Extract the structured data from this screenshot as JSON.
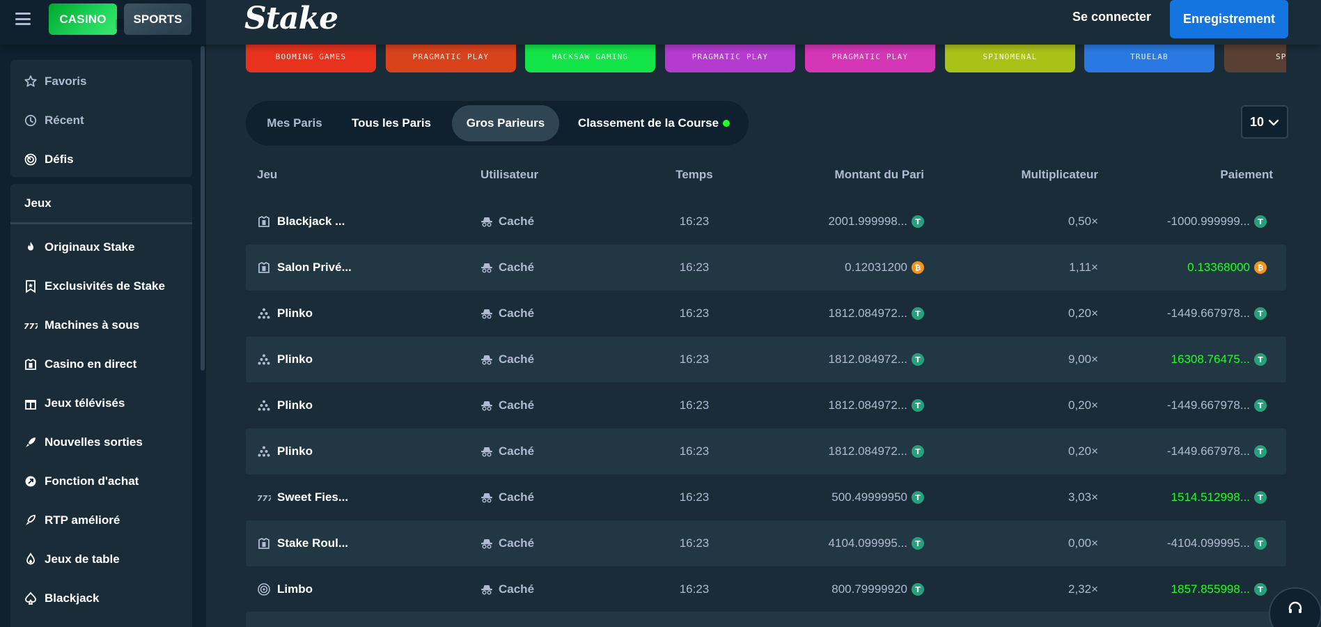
{
  "header": {
    "casino_label": "CASINO",
    "sports_label": "SPORTS",
    "logo_text": "Stake",
    "login_label": "Se connecter",
    "register_label": "Enregistrement"
  },
  "sidebar": {
    "top_items": [
      {
        "label": "Favoris",
        "icon": "star-icon"
      },
      {
        "label": "Récent",
        "icon": "history-icon"
      },
      {
        "label": "Défis",
        "icon": "target-icon"
      }
    ],
    "section_title": "Jeux",
    "items": [
      {
        "label": "Originaux Stake",
        "icon": "fire-icon"
      },
      {
        "label": "Exclusivités de Stake",
        "icon": "bookmark-star-icon"
      },
      {
        "label": "Machines à sous",
        "icon": "slots-777-icon"
      },
      {
        "label": "Casino en direct",
        "icon": "live-dealer-icon"
      },
      {
        "label": "Jeux télévisés",
        "icon": "gift-icon"
      },
      {
        "label": "Nouvelles sorties",
        "icon": "rocket-icon"
      },
      {
        "label": "Fonction d'achat",
        "icon": "buy-feature-icon"
      },
      {
        "label": "RTP amélioré",
        "icon": "rocket-tag-icon"
      },
      {
        "label": "Jeux de table",
        "icon": "flame-drop-icon"
      },
      {
        "label": "Blackjack",
        "icon": "spade-icon"
      }
    ]
  },
  "providers": [
    {
      "name": "BOOMING GAMES",
      "color": "#e8321e"
    },
    {
      "name": "PRAGMATIC PLAY",
      "color": "#d8431c"
    },
    {
      "name": "HACKSAW GAMING",
      "color": "#13e447"
    },
    {
      "name": "PRAGMATIC PLAY",
      "color": "#b43ad0"
    },
    {
      "name": "PRAGMATIC PLAY",
      "color": "#d436b6"
    },
    {
      "name": "SPINOMENAL",
      "color": "#a8c218"
    },
    {
      "name": "TRUELAB",
      "color": "#2a78e2"
    },
    {
      "name": "SPINO",
      "color": "#5a4034"
    }
  ],
  "tabs": [
    {
      "label": "Mes Paris",
      "state": "muted"
    },
    {
      "label": "Tous les Paris",
      "state": "normal"
    },
    {
      "label": "Gros Parieurs",
      "state": "active"
    },
    {
      "label": "Classement de la Course",
      "state": "normal",
      "live": true
    }
  ],
  "count_select": {
    "value": "10"
  },
  "table": {
    "headers": {
      "game": "Jeu",
      "user": "Utilisateur",
      "time": "Temps",
      "amount": "Montant du Pari",
      "multiplier": "Multiplicateur",
      "payout": "Paiement"
    },
    "rows": [
      {
        "game": "Blackjack ...",
        "game_icon": "live-dealer-icon",
        "user": "Caché",
        "time": "16:23",
        "amount": "2001.999998...",
        "amount_coin": "usdt",
        "multiplier": "0,50×",
        "payout": "-1000.999999...",
        "payout_coin": "usdt",
        "win": false
      },
      {
        "game": "Salon Privé...",
        "game_icon": "live-dealer-icon",
        "user": "Caché",
        "time": "16:23",
        "amount": "0.12031200",
        "amount_coin": "btc",
        "multiplier": "1,11×",
        "payout": "0.13368000",
        "payout_coin": "btc",
        "win": true
      },
      {
        "game": "Plinko",
        "game_icon": "plinko-icon",
        "user": "Caché",
        "time": "16:23",
        "amount": "1812.084972...",
        "amount_coin": "usdt",
        "multiplier": "0,20×",
        "payout": "-1449.667978...",
        "payout_coin": "usdt",
        "win": false
      },
      {
        "game": "Plinko",
        "game_icon": "plinko-icon",
        "user": "Caché",
        "time": "16:23",
        "amount": "1812.084972...",
        "amount_coin": "usdt",
        "multiplier": "9,00×",
        "payout": "16308.76475...",
        "payout_coin": "usdt",
        "win": true
      },
      {
        "game": "Plinko",
        "game_icon": "plinko-icon",
        "user": "Caché",
        "time": "16:23",
        "amount": "1812.084972...",
        "amount_coin": "usdt",
        "multiplier": "0,20×",
        "payout": "-1449.667978...",
        "payout_coin": "usdt",
        "win": false
      },
      {
        "game": "Plinko",
        "game_icon": "plinko-icon",
        "user": "Caché",
        "time": "16:23",
        "amount": "1812.084972...",
        "amount_coin": "usdt",
        "multiplier": "0,20×",
        "payout": "-1449.667978...",
        "payout_coin": "usdt",
        "win": false
      },
      {
        "game": "Sweet Fies...",
        "game_icon": "slots-777-icon",
        "user": "Caché",
        "time": "16:23",
        "amount": "500.49999950",
        "amount_coin": "usdt",
        "multiplier": "3,03×",
        "payout": "1514.512998...",
        "payout_coin": "usdt",
        "win": true
      },
      {
        "game": "Stake Roul...",
        "game_icon": "live-dealer-icon",
        "user": "Caché",
        "time": "16:23",
        "amount": "4104.099995...",
        "amount_coin": "usdt",
        "multiplier": "0,00×",
        "payout": "-4104.099995...",
        "payout_coin": "usdt",
        "win": false
      },
      {
        "game": "Limbo",
        "game_icon": "limbo-icon",
        "user": "Caché",
        "time": "16:23",
        "amount": "800.79999920",
        "amount_coin": "usdt",
        "multiplier": "2,32×",
        "payout": "1857.855998...",
        "payout_coin": "usdt",
        "win": true
      }
    ]
  },
  "colors": {
    "background": "#1a2c38",
    "sidebar": "#0f212e",
    "row_alt": "#213743",
    "accent_blue": "#1475e1",
    "win_green": "#1fff20",
    "muted_text": "#b1bad3"
  }
}
